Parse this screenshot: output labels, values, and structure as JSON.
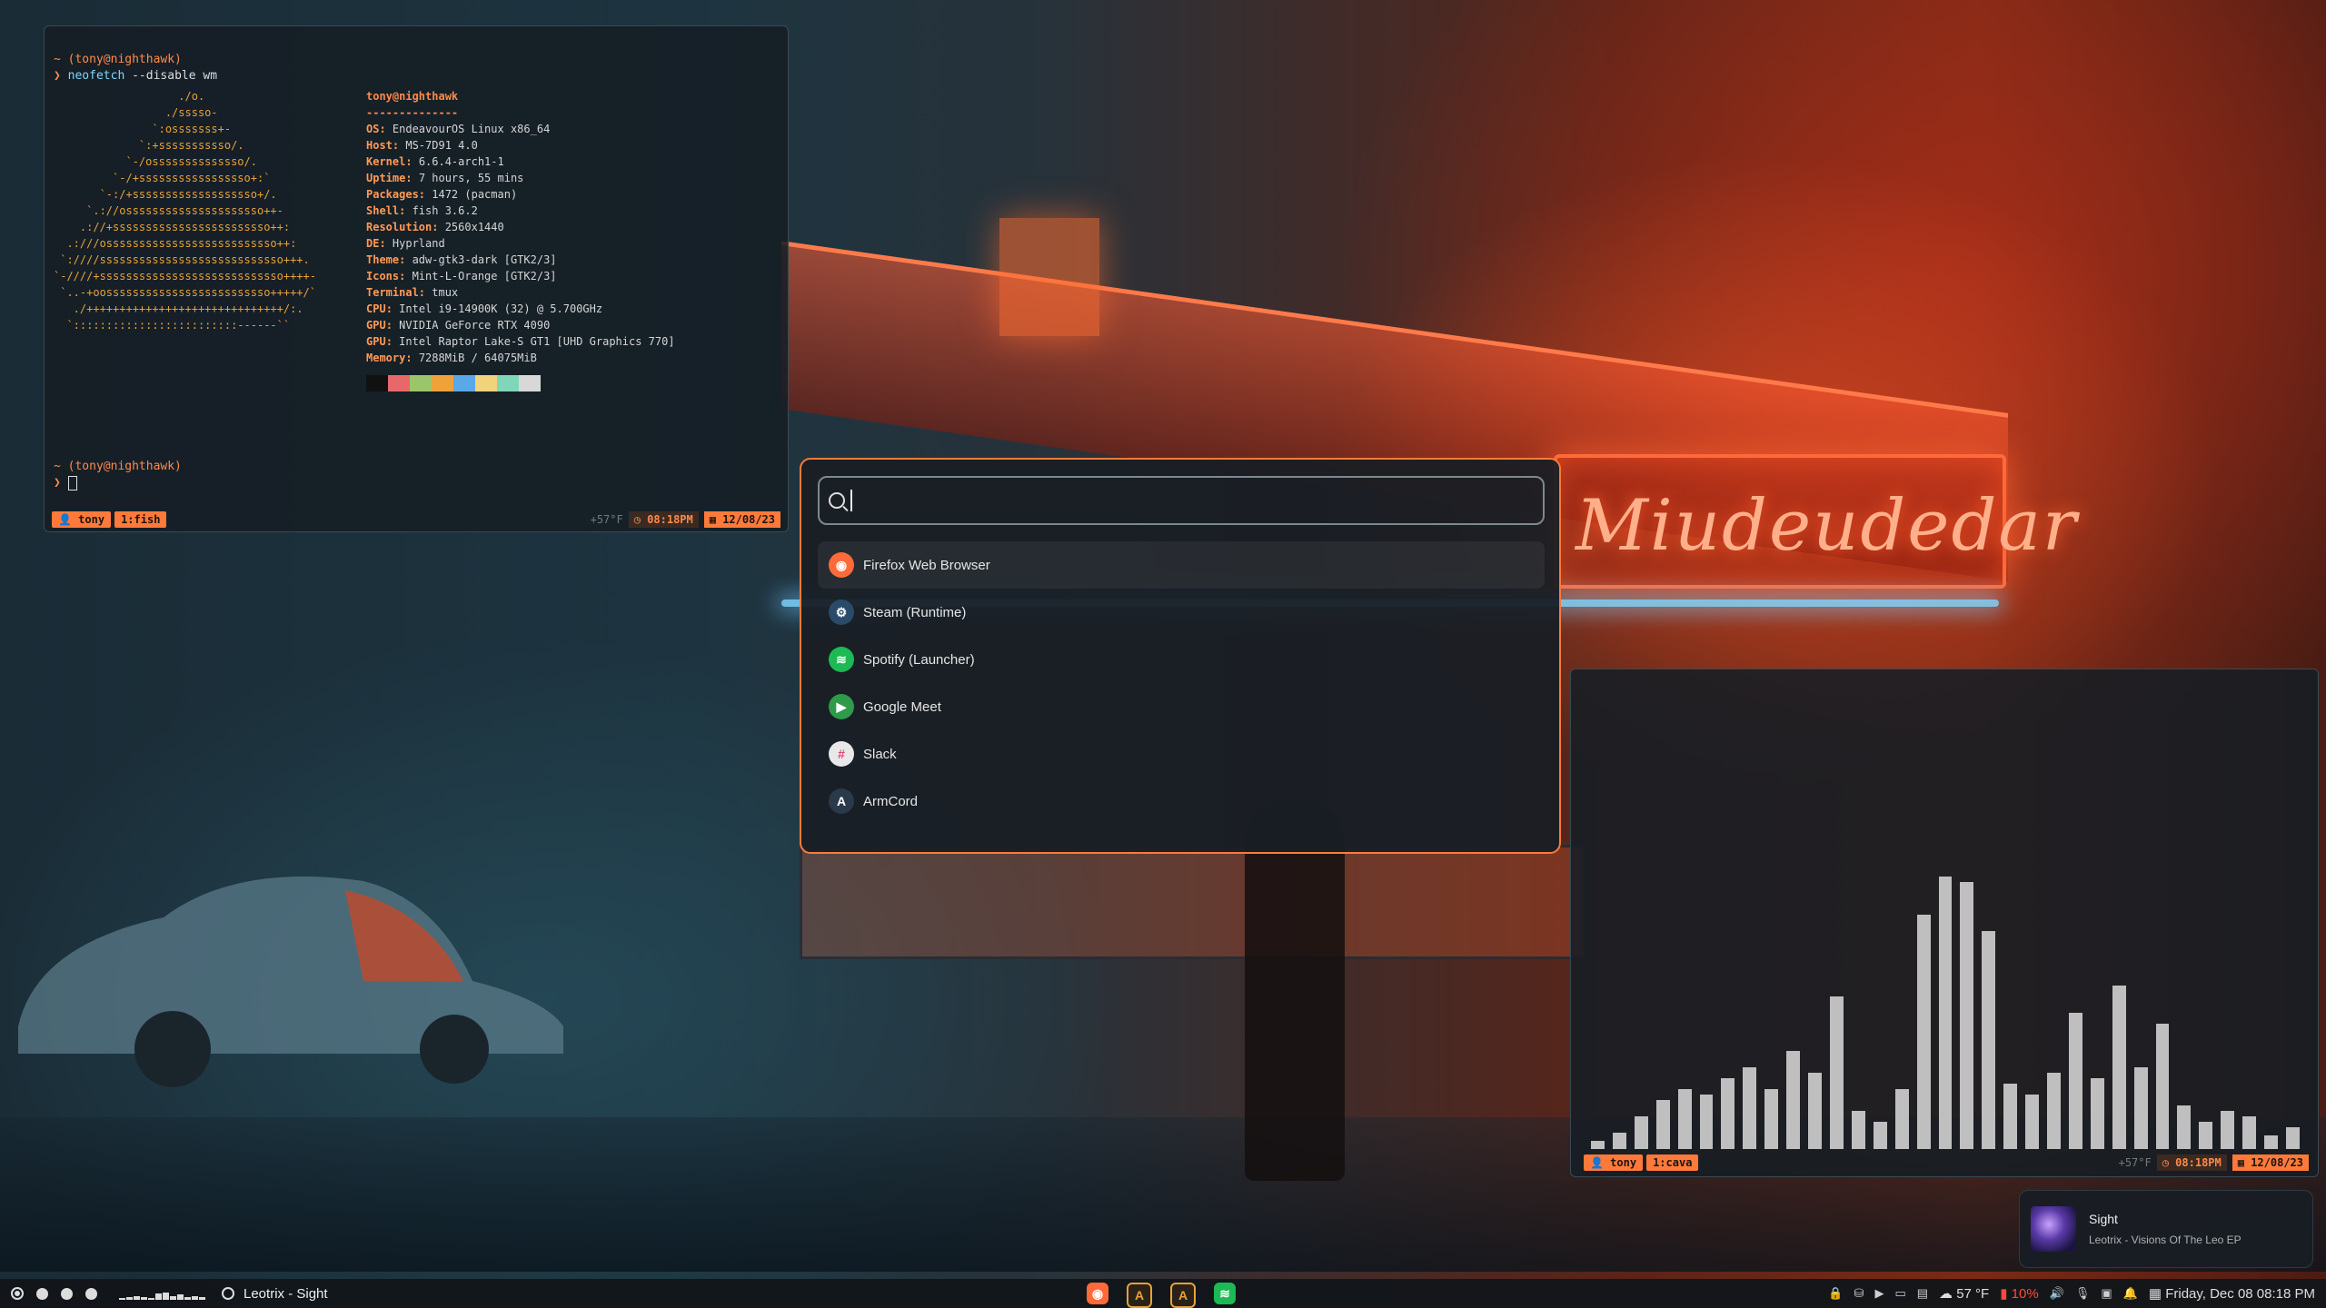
{
  "terminal_fish": {
    "prompt1": "~ (tony@nighthawk)",
    "arrow": "❯",
    "command_name": "neofetch",
    "command_args": " --disable wm",
    "logo_lines": [
      "                   ./o.",
      "                 ./sssso-",
      "               `:osssssss+-",
      "             `:+sssssssssso/.",
      "           `-/ossssssssssssso/.",
      "         `-/+sssssssssssssssso+:`",
      "       `-:/+sssssssssssssssssso+/.",
      "     `.://osssssssssssssssssssso++-",
      "    .://+ssssssssssssssssssssssso++:",
      "  .:///ossssssssssssssssssssssssso++:",
      " `:////ssssssssssssssssssssssssssso+++.",
      "`-////+ssssssssssssssssssssssssssso++++-",
      " `..-+oosssssssssssssssssssssssso+++++/`",
      "   ./++++++++++++++++++++++++++++++/:.",
      "  `:::::::::::::::::::::::::------``"
    ],
    "user_host": "tony@nighthawk",
    "separator": "--------------",
    "info": [
      {
        "k": "OS",
        "v": "EndeavourOS Linux x86_64"
      },
      {
        "k": "Host",
        "v": "MS-7D91 4.0"
      },
      {
        "k": "Kernel",
        "v": "6.6.4-arch1-1"
      },
      {
        "k": "Uptime",
        "v": "7 hours, 55 mins"
      },
      {
        "k": "Packages",
        "v": "1472 (pacman)"
      },
      {
        "k": "Shell",
        "v": "fish 3.6.2"
      },
      {
        "k": "Resolution",
        "v": "2560x1440"
      },
      {
        "k": "DE",
        "v": "Hyprland"
      },
      {
        "k": "Theme",
        "v": "adw-gtk3-dark [GTK2/3]"
      },
      {
        "k": "Icons",
        "v": "Mint-L-Orange [GTK2/3]"
      },
      {
        "k": "Terminal",
        "v": "tmux"
      },
      {
        "k": "CPU",
        "v": "Intel i9-14900K (32) @ 5.700GHz"
      },
      {
        "k": "GPU",
        "v": "NVIDIA GeForce RTX 4090"
      },
      {
        "k": "GPU",
        "v": "Intel Raptor Lake-S GT1 [UHD Graphics 770]"
      },
      {
        "k": "Memory",
        "v": "7288MiB / 64075MiB"
      }
    ],
    "swatch_colors": [
      "#111111",
      "#e8686a",
      "#9cc46a",
      "#f0a23a",
      "#5aa8e8",
      "#f2d27a",
      "#7fd6b8",
      "#d8d8d8"
    ],
    "prompt2": "~ (tony@nighthawk)",
    "tmux": {
      "user": "tony",
      "window": "1:fish",
      "temp": "+57°F",
      "time": "08:18PM",
      "date": "12/08/23"
    }
  },
  "launcher": {
    "search_value": "",
    "apps": [
      {
        "label": "Firefox Web Browser",
        "icon": "firefox-icon",
        "color": "#ff6a3a",
        "glyph": "◉"
      },
      {
        "label": "Steam (Runtime)",
        "icon": "steam-icon",
        "color": "#2a4a6a",
        "glyph": "⚙"
      },
      {
        "label": "Spotify (Launcher)",
        "icon": "spotify-icon",
        "color": "#1db954",
        "glyph": "≋"
      },
      {
        "label": "Google Meet",
        "icon": "google-meet-icon",
        "color": "#2e9a4a",
        "glyph": "▶"
      },
      {
        "label": "Slack",
        "icon": "slack-icon",
        "color": "#e8e8e8",
        "glyph": "#"
      },
      {
        "label": "ArmCord",
        "icon": "armcord-icon",
        "color": "#2a3a4a",
        "glyph": "A"
      }
    ]
  },
  "cava": {
    "tmux": {
      "user": "tony",
      "window": "1:cava",
      "temp": "+57°F",
      "time": "08:18PM",
      "date": "12/08/23"
    },
    "levels": [
      0.03,
      0.06,
      0.12,
      0.18,
      0.22,
      0.2,
      0.26,
      0.3,
      0.22,
      0.36,
      0.28,
      0.56,
      0.14,
      0.1,
      0.22,
      0.86,
      1.0,
      0.98,
      0.8,
      0.24,
      0.2,
      0.28,
      0.5,
      0.26,
      0.6,
      0.3,
      0.46,
      0.16,
      0.1,
      0.14,
      0.12,
      0.05,
      0.08
    ]
  },
  "notification": {
    "title": "Sight",
    "subtitle": "Leotrix - Visions Of The Leo EP"
  },
  "taskbar": {
    "workspaces": [
      true,
      false,
      false,
      false
    ],
    "spark": [
      0.1,
      0.2,
      0.3,
      0.2,
      0.15,
      0.5,
      0.6,
      0.25,
      0.4,
      0.2,
      0.3,
      0.2
    ],
    "now_playing": "Leotrix - Sight",
    "dock": [
      {
        "icon": "firefox-icon",
        "color": "#ff6a3a",
        "glyph": "◉"
      },
      {
        "icon": "alacritty-icon",
        "color": "#e8a23a",
        "glyph": "A"
      },
      {
        "icon": "alacritty-icon-2",
        "color": "#e8a23a",
        "glyph": "A"
      },
      {
        "icon": "spotify-icon",
        "color": "#1db954",
        "glyph": "≋"
      }
    ],
    "weather": "57 °F",
    "battery": "10%",
    "datetime": "Friday, Dec 08 08:18 PM"
  }
}
